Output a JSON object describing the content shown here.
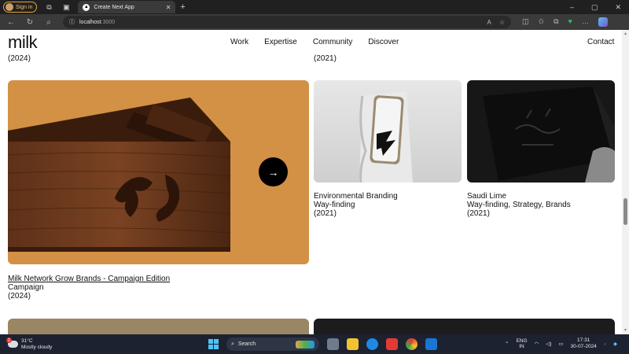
{
  "browser": {
    "signin_label": "Sign in",
    "tab_title": "Create Next App",
    "url_host": "localhost",
    "url_port": ":3000"
  },
  "site": {
    "logo": "milk",
    "nav": [
      "Work",
      "Expertise",
      "Community",
      "Discover"
    ],
    "contact": "Contact"
  },
  "projects": {
    "top_left_year": "(2024)",
    "top_right_year": "(2021)",
    "featured": {
      "title": "Milk Network Grow Brands - Campaign Edition",
      "category": "Campaign",
      "year": "(2024)",
      "arrow": "→"
    },
    "environmental": {
      "title": "Environmental Branding",
      "category": "Way-finding",
      "year": "(2021)"
    },
    "saudi": {
      "title": "Saudi Lime",
      "category": "Way-finding, Strategy, Brands",
      "year": "(2021)"
    }
  },
  "taskbar": {
    "weather_temp": "31°C",
    "weather_desc": "Mostly cloudy",
    "weather_badge": "1",
    "search_label": "Search",
    "lang_top": "ENG",
    "lang_bottom": "IN",
    "time": "17:31",
    "date": "30-07-2024"
  },
  "colors": {
    "featured_card": "#d29145",
    "taskbar": "#1c2230"
  }
}
